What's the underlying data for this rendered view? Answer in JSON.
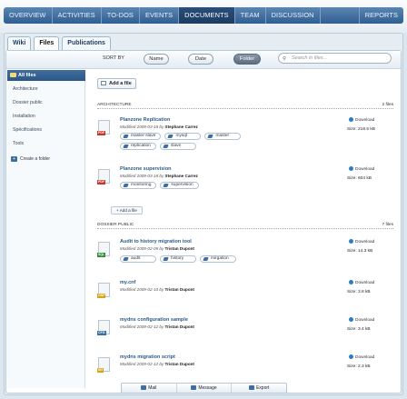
{
  "nav": {
    "items": [
      "OVERVIEW",
      "ACTIVITIES",
      "TO-DOS",
      "EVENTS",
      "DOCUMENTS",
      "TEAM",
      "DISCUSSION"
    ],
    "right_item": "REPORTS",
    "active": "DOCUMENTS"
  },
  "tabs": [
    "Wiki",
    "Files",
    "Publications"
  ],
  "sort": {
    "label": "SORT BY",
    "options": [
      "Name",
      "Date",
      "Folder"
    ],
    "active": "Folder",
    "search_placeholder": "Search in files..."
  },
  "sidebar": {
    "selected": "All files",
    "items": [
      "Architecture",
      "Dossier public",
      "Installation",
      "Spécifications",
      "Tools"
    ],
    "create_label": "Create a folder"
  },
  "add_file_label": "Add a file",
  "add_tag_label": "+ Add a file",
  "sections": [
    {
      "name": "ARCHITECTURE",
      "count": "2 files"
    },
    {
      "name": "DOSSIER PUBLIC",
      "count": "7 files"
    }
  ],
  "files": [
    {
      "name": "Planzone Replication",
      "meta": "Modified 2009-03-18 by ",
      "author": "Stephane Carrez",
      "size": "Size: 218.5 kB",
      "download": "Download",
      "tags": [
        "master-slave",
        "mysql",
        "master",
        "replication",
        "slave"
      ],
      "type": "PDF"
    },
    {
      "name": "Planzone supervision",
      "meta": "Modified 2009-03-18 by ",
      "author": "Stephane Carrez",
      "size": "Size: 604 kB",
      "download": "Download",
      "tags": [
        "monitoring",
        "supervision"
      ],
      "type": "PDF"
    },
    {
      "name": "Audit to history migration tool",
      "meta": "Modified 2009-02-05 by ",
      "author": "Tristan Dupont",
      "size": "Size: 14.3 kB",
      "download": "Download",
      "tags": [
        "audit",
        "history",
        "mirgation"
      ],
      "type": "SQL"
    },
    {
      "name": "my.cnf",
      "meta": "Modified 2009-02-10 by ",
      "author": "Tristan Dupont",
      "size": "Size: 3.8 kB",
      "download": "Download",
      "tags": [],
      "type": "CNF"
    },
    {
      "name": "mydns configuration sample",
      "meta": "Modified 2009-02-12 by ",
      "author": "Tristan Dupont",
      "size": "Size: 3.4 kB",
      "download": "Download",
      "tags": [],
      "type": "CFG"
    },
    {
      "name": "mydns migration script",
      "meta": "Modified 2009-02-12 by ",
      "author": "Tristan Dupont",
      "size": "Size: 2.3 kB",
      "download": "Download",
      "tags": [],
      "type": "SH"
    }
  ],
  "footer": [
    "Mail",
    "Message",
    "Export"
  ],
  "colors": {
    "nav": "#2f5e91",
    "link": "#2c5a8c",
    "download": "#2e7bc8"
  }
}
